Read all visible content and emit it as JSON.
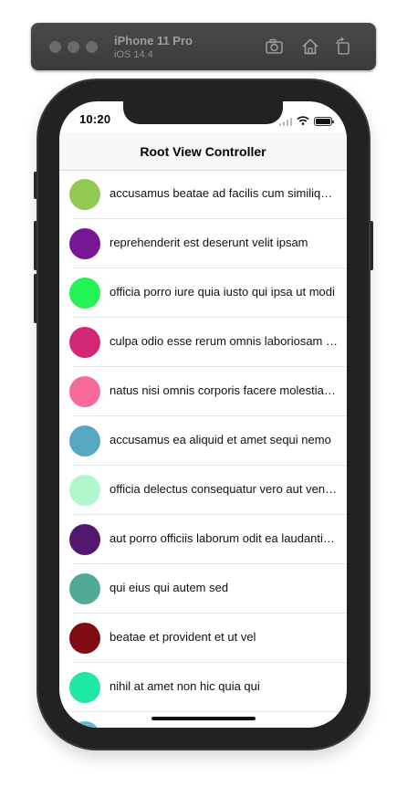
{
  "simulator": {
    "device_name": "iPhone 11 Pro",
    "os_version": "iOS 14.4",
    "toolbar_icons": [
      "screenshot-icon",
      "home-icon",
      "rotate-icon"
    ]
  },
  "status_bar": {
    "time": "10:20",
    "icons": [
      "cellular-signal-icon",
      "wifi-icon",
      "battery-icon"
    ]
  },
  "nav": {
    "title": "Root View Controller"
  },
  "rows": [
    {
      "label": "accusamus beatae ad facilis cum similique qui sunt",
      "color": "#92c952"
    },
    {
      "label": "reprehenderit est deserunt velit ipsam",
      "color": "#771796"
    },
    {
      "label": "officia porro iure quia iusto qui ipsa ut modi",
      "color": "#24f355"
    },
    {
      "label": "culpa odio esse rerum omnis laboriosam voluptate repudiandae",
      "color": "#d32776"
    },
    {
      "label": "natus nisi omnis corporis facere molestiae rerum in",
      "color": "#f66b97"
    },
    {
      "label": "accusamus ea aliquid et amet sequi nemo",
      "color": "#56a8c2"
    },
    {
      "label": "officia delectus consequatur vero aut veniam explicabo molestias",
      "color": "#b0f7cc"
    },
    {
      "label": "aut porro officiis laborum odit ea laudantium corporis",
      "color": "#54176f"
    },
    {
      "label": "qui eius qui autem sed",
      "color": "#51aa97"
    },
    {
      "label": "beatae et provident et ut vel",
      "color": "#810b14"
    },
    {
      "label": "nihil at amet non hic quia qui",
      "color": "#1ee8a4"
    },
    {
      "label": "",
      "color": "#66b7d2"
    }
  ]
}
